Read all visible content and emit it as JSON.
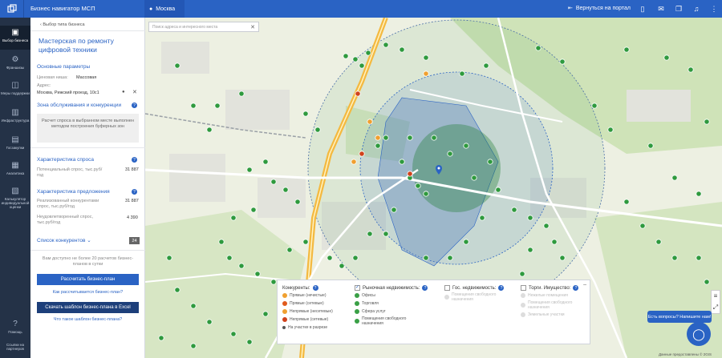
{
  "topbar": {
    "app_title": "Бизнес навигатор МСП",
    "region": "Москва",
    "back_label": "Вернуться на портал"
  },
  "leftnav": {
    "items": [
      {
        "label": "Выбор бизнеса",
        "icon": "briefcase-icon"
      },
      {
        "label": "Франшизы",
        "icon": "franchise-icon"
      },
      {
        "label": "Меры поддержки",
        "icon": "support-icon"
      },
      {
        "label": "Инфраструктура",
        "icon": "infrastructure-icon"
      },
      {
        "label": "Госзакупки",
        "icon": "procurement-icon"
      },
      {
        "label": "Аналитика",
        "icon": "analytics-icon"
      },
      {
        "label": "Калькулятор индивидуальной оценки",
        "icon": "calculator-icon"
      }
    ],
    "help_label": "Помощь",
    "extra_label": "Ссылки на партнеров"
  },
  "panel": {
    "breadcrumb": "Выбор типа бизнеса",
    "title": "Мастерская по ремонту цифровой техники",
    "main_params_title": "Основные параметры",
    "city_label": "Ценовая ниша:",
    "city_value": "Массовая",
    "address_label": "Адрес:",
    "address_value": "Москва, Рижский проезд, 10с1",
    "zone_title": "Зона обслуживания и конкуренции",
    "zone_note": "Расчет спроса в выбранном месте выполнен методом построения буферных зон",
    "demand_title": "Характеристика спроса",
    "demand_label": "Потенциальный спрос, тыс.руб/год",
    "demand_value": "31 887",
    "supply_title": "Характеристика предложения",
    "supply_label": "Реализованный конкурентами спрос, тыс.руб/год",
    "supply_value": "31 887",
    "unmet_label": "Неудовлетворенный спрос, тыс.руб/год",
    "unmet_value": "4 390",
    "competitors_label": "Список конкурентов",
    "competitors_count": "24",
    "note": "Вам доступно не более 20 расчетов бизнес-планов в сутки",
    "calc_button": "Рассчитать бизнес-план",
    "how_link": "Как рассчитывается бизнес-план?",
    "download_button": "Скачать шаблон бизнес-плана в Excel",
    "what_link": "Что такое шаблон бизнес-плана?"
  },
  "map": {
    "search_placeholder": "Поиск адреса и интересного места",
    "attribution": "Данные предоставлены © 2GIS",
    "chat_label": "Есть вопросы? Напишите нам!",
    "legend": {
      "competitors": {
        "title": "Конкуренты:",
        "items": [
          {
            "label": "Прямые (нечистые)",
            "color": "#f0a030"
          },
          {
            "label": "Прямые (сетевые)",
            "color": "#e05a1c"
          },
          {
            "label": "Непрямые (несетевые)",
            "color": "#f0a030"
          },
          {
            "label": "Непрямые (сетевые)",
            "color": "#d0421c"
          },
          {
            "label": "На участке в разрезе",
            "color": "#555555"
          }
        ]
      },
      "market": {
        "title": "Рыночная недвижимость:",
        "items": [
          {
            "label": "Офисы",
            "color": "#3aa046"
          },
          {
            "label": "Торговля",
            "color": "#3aa046"
          },
          {
            "label": "Сфера услуг",
            "color": "#3aa046"
          },
          {
            "label": "Помещения свободного назначения",
            "color": "#3aa046"
          }
        ]
      },
      "gov": {
        "title": "Гос. недвижимость:",
        "items": [
          {
            "label": "Помещения свободного назначения"
          }
        ]
      },
      "auctions": {
        "title": "Торги. Имущество:",
        "items": [
          {
            "label": "Нежилые помещения"
          },
          {
            "label": "Помещения свободного назначения"
          },
          {
            "label": "Земельные участки"
          }
        ]
      }
    }
  },
  "colors": {
    "brand": "#2a63c4",
    "nav": "#243247",
    "marker": "#2f9a3e"
  }
}
